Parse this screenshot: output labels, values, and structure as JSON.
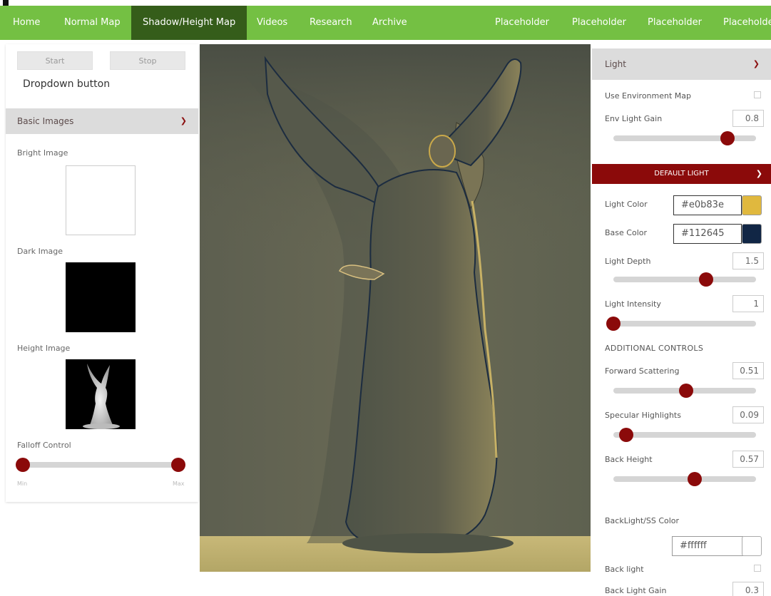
{
  "nav": {
    "items": [
      {
        "label": "Home"
      },
      {
        "label": "Normal Map"
      },
      {
        "label": "Shadow/Height Map"
      },
      {
        "label": "Videos"
      },
      {
        "label": "Research"
      },
      {
        "label": "Archive"
      },
      {
        "label": "Placeholder"
      },
      {
        "label": "Placeholder"
      },
      {
        "label": "Placeholder"
      },
      {
        "label": "Placeholde"
      }
    ],
    "active": "Shadow/Height Map",
    "bar_color": "#74c043",
    "active_color": "#355d1a"
  },
  "left": {
    "start_label": "Start",
    "stop_label": "Stop",
    "dropdown_label": "Dropdown button",
    "section_title": "Basic Images",
    "bright_label": "Bright Image",
    "dark_label": "Dark Image",
    "height_label": "Height Image",
    "falloff_label": "Falloff Control",
    "falloff_min_label": "Min",
    "falloff_max_label": "Max",
    "falloff_range": [
      0,
      1
    ]
  },
  "right": {
    "light_title": "Light",
    "use_env_label": "Use Environment Map",
    "env_gain_label": "Env Light Gain",
    "env_gain_value": "0.8",
    "env_gain_fraction": 0.8,
    "default_light_title": "DEFAULT LIGHT",
    "light_color_label": "Light Color",
    "light_color_value": "#e0b83e",
    "base_color_label": "Base Color",
    "base_color_value": "#112645",
    "light_depth_label": "Light Depth",
    "light_depth_value": "1.5",
    "light_depth_fraction": 0.65,
    "light_intensity_label": "Light Intensity",
    "light_intensity_value": "1",
    "light_intensity_fraction": 0.0,
    "additional_label": "ADDITIONAL CONTROLS",
    "forward_label": "Forward Scattering",
    "forward_value": "0.51",
    "forward_fraction": 0.51,
    "specular_label": "Specular Highlights",
    "specular_value": "0.09",
    "specular_fraction": 0.09,
    "back_height_label": "Back Height",
    "back_height_value": "0.57",
    "back_height_fraction": 0.57,
    "backlight_ss_label": "BackLight/SS Color",
    "backlight_ss_value": "#ffffff",
    "back_light_label": "Back light",
    "back_light_gain_label": "Back Light Gain",
    "back_light_gain_value": "0.3"
  },
  "colors": {
    "accent": "#8b0a0a",
    "section_bg": "#dcdcdc"
  }
}
